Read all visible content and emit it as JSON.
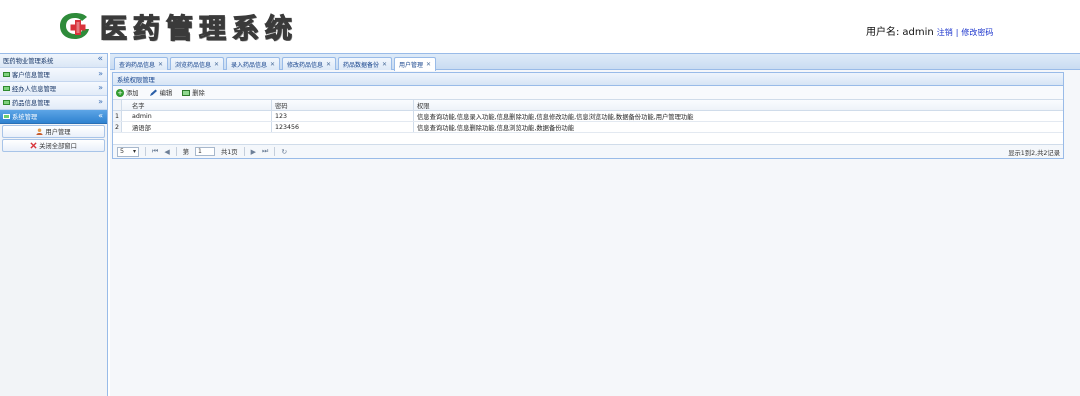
{
  "header": {
    "app_title": "医药管理系统",
    "user_label": "用户名:",
    "username": "admin",
    "logout_link": "注销",
    "change_password_link": "修改密码",
    "brand_colors": {
      "green": "#2e8b3a",
      "red": "#d8333a"
    }
  },
  "sidebar": {
    "title": "医药物业管理系统",
    "sections": [
      {
        "label": "客户信息管理",
        "icon": "green-card-icon"
      },
      {
        "label": "经办人信息管理",
        "icon": "green-card-icon"
      },
      {
        "label": "药品信息管理",
        "icon": "green-card-icon"
      },
      {
        "label": "系统管理",
        "icon": "green-card-icon",
        "active": true
      }
    ],
    "sub_items": [
      {
        "label": "用户管理",
        "icon": "user-icon"
      },
      {
        "label": "关闭全部窗口",
        "icon": "close-windows-icon"
      }
    ]
  },
  "tabs": [
    {
      "label": "查询药品信息"
    },
    {
      "label": "浏览药品信息"
    },
    {
      "label": "录入药品信息"
    },
    {
      "label": "修改药品信息"
    },
    {
      "label": "药品数据备份"
    },
    {
      "label": "用户管理",
      "active": true
    }
  ],
  "panel": {
    "title": "系统权限管理",
    "toolbar": {
      "add": "添加",
      "edit": "编辑",
      "delete": "删除"
    },
    "columns": {
      "name": "名字",
      "password": "密码",
      "permission": "权限"
    },
    "rows": [
      {
        "idx": "1",
        "name": "admin",
        "password": "123",
        "permission": "信息查询功能,信息录入功能,信息删除功能,信息修改功能,信息浏览功能,数据备份功能,用户管理功能"
      },
      {
        "idx": "2",
        "name": "涵语部",
        "password": "123456",
        "permission": "信息查询功能,信息删除功能,信息浏览功能,数据备份功能"
      }
    ],
    "pager": {
      "page_size": "5",
      "page_label_before": "第",
      "page_value": "1",
      "page_label_after": "共1页",
      "info": "显示1到2,共2记录"
    }
  }
}
